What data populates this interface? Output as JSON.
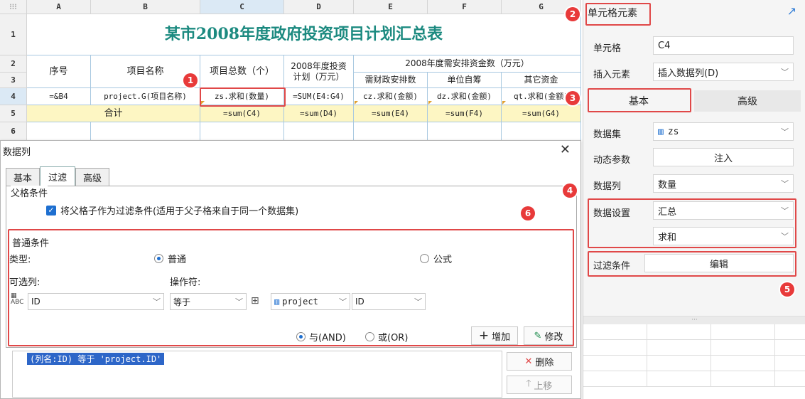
{
  "sheet": {
    "columns": [
      "A",
      "B",
      "C",
      "D",
      "E",
      "F",
      "G"
    ],
    "rows": [
      "1",
      "2",
      "3",
      "4",
      "5",
      "6"
    ],
    "title": "某市2008年度政府投资项目计划汇总表",
    "headers": {
      "seq": "序号",
      "name": "项目名称",
      "total": "项目总数（个）",
      "plan_line1": "2008年度投资",
      "plan_line2": "计划（万元）",
      "funds": "2008年度需安排资金数（万元）",
      "fiscal": "需财政安排数",
      "self": "单位自筹",
      "other": "其它资金"
    },
    "row4": {
      "a": "=&B4",
      "b": "project.G(项目名称)",
      "c": "zs.求和(数量)",
      "d": "=SUM(E4:G4)",
      "e": "cz.求和(金额)",
      "f": "dz.求和(金额)",
      "g": "qt.求和(金额)"
    },
    "row5": {
      "label": "合计",
      "c": "=sum(C4)",
      "d": "=sum(D4)",
      "e": "=sum(E4)",
      "f": "=sum(F4)",
      "g": "=sum(G4)"
    }
  },
  "dialog": {
    "title": "数据列",
    "tabs": [
      "基本",
      "过滤",
      "高级"
    ],
    "parent_group": "父格条件",
    "parent_checkbox": "将父格子作为过滤条件(适用于父子格来自于同一个数据集)",
    "normal_group": "普通条件",
    "type_label": "类型:",
    "type_normal": "普通",
    "type_formula": "公式",
    "optional_col_label": "可选列:",
    "operator_label": "操作符:",
    "col_value": "ID",
    "operator_value": "等于",
    "dataset_value": "project",
    "dataset_col_value": "ID",
    "and_label": "与(AND)",
    "or_label": "或(OR)",
    "add_button": "增加",
    "modify_button": "修改",
    "condition_text": "(列名:ID) 等于 'project.ID'",
    "delete_button": "删除",
    "up_button": "上移"
  },
  "panel": {
    "title": "单元格元素",
    "cell_label": "单元格",
    "cell_value": "C4",
    "insert_label": "插入元素",
    "insert_value": "插入数据列(D)",
    "tab_basic": "基本",
    "tab_advanced": "高级",
    "dataset_label": "数据集",
    "dataset_value": "zs",
    "param_label": "动态参数",
    "param_button": "注入",
    "column_label": "数据列",
    "column_value": "数量",
    "setting_label": "数据设置",
    "setting_value": "汇总",
    "setting_sub_value": "求和",
    "filter_label": "过滤条件",
    "filter_button": "编辑",
    "handle": "···"
  },
  "badges": [
    "1",
    "2",
    "3",
    "4",
    "5",
    "6"
  ],
  "colors": {
    "title_teal": "#1c8a80",
    "highlight_red": "#e04848",
    "badge_red": "#e83a3a",
    "formula_yellow": "#fdf6c3",
    "accent_blue": "#1e6fd0"
  }
}
